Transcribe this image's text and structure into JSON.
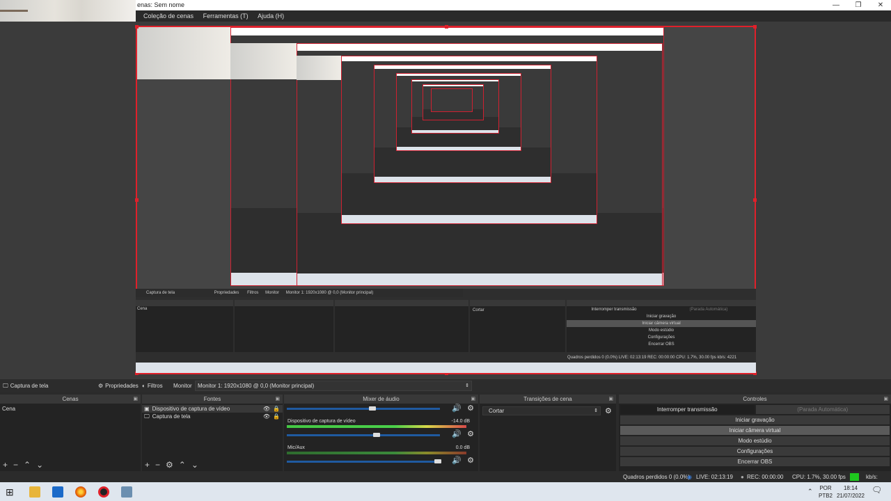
{
  "window": {
    "title": "enas: Sem nome",
    "controls": [
      "—",
      "❐",
      "✕"
    ]
  },
  "menu": [
    "Coleção de cenas",
    "Ferramentas (T)",
    "Ajuda (H)"
  ],
  "toolbar": {
    "source_name": "Captura de tela",
    "properties_label": "Propriedades",
    "filters_label": "Filtros",
    "monitor_label": "Monitor",
    "monitor_value": "Monitor 1: 1920x1080 @ 0,0 (Monitor principal)"
  },
  "scenes": {
    "title": "Cenas",
    "items": [
      "Cena"
    ]
  },
  "sources": {
    "title": "Fontes",
    "items": [
      "Dispositivo de captura de vídeo",
      "Captura de tela"
    ]
  },
  "mixer": {
    "title": "Mixer de áudio",
    "channels": [
      {
        "name": "",
        "level": ""
      },
      {
        "name": "Dispositivo de captura de vídeo",
        "level": "-14.0 dB"
      },
      {
        "name": "Mic/Aux",
        "level": "0.0 dB"
      }
    ]
  },
  "transitions": {
    "title": "Transições de cena",
    "value": "Cortar"
  },
  "controls": {
    "title": "Controles",
    "stop_stream": "Interromper transmissão",
    "auto_stop": "(Parada Automática)",
    "start_recording": "Iniciar gravação",
    "start_virtual_cam": "Iniciar câmera virtual",
    "studio_mode": "Modo estúdio",
    "settings": "Configurações",
    "exit": "Encerrar OBS"
  },
  "status": {
    "dropped": "Quadros perdidos 0 (0.0%)",
    "live": "LIVE: 02:13:19",
    "rec": "REC: 00:00:00",
    "cpu": "CPU: 1.7%, 30.00 fps",
    "kbps": "kb/s: 4221"
  },
  "taskbar": {
    "lang_top": "POR",
    "lang_bottom": "PTB2",
    "time": "18:14",
    "date": "21/07/2022"
  },
  "preview_dock": {
    "source_name": "Captura de tela",
    "properties_label": "Propriedades",
    "filters_label": "Filtros",
    "monitor_label": "Monitor",
    "monitor_value": "Monitor 1: 1920x1080 @ 0,0 (Monitor principal)",
    "scene": "Cena",
    "transition": "Cortar",
    "stop_stream": "Interromper transmissão",
    "auto_stop": "(Parada Automática)",
    "start_recording": "Iniciar gravação",
    "start_virtual_cam": "Iniciar câmera virtual",
    "studio_mode": "Modo estúdio",
    "settings": "Configurações",
    "exit": "Encerrar OBS",
    "status": "Quadros perdidos 0 (0.0%)   LIVE: 02:13:19   REC: 00:00:00   CPU: 1.7%, 30.00 fps   kb/s: 4221"
  },
  "colors": {
    "accent_red": "#e0202a",
    "meter_green": "#44c844",
    "slider_blue": "#1f5aa0",
    "live_indicator": "#1ec81e"
  }
}
